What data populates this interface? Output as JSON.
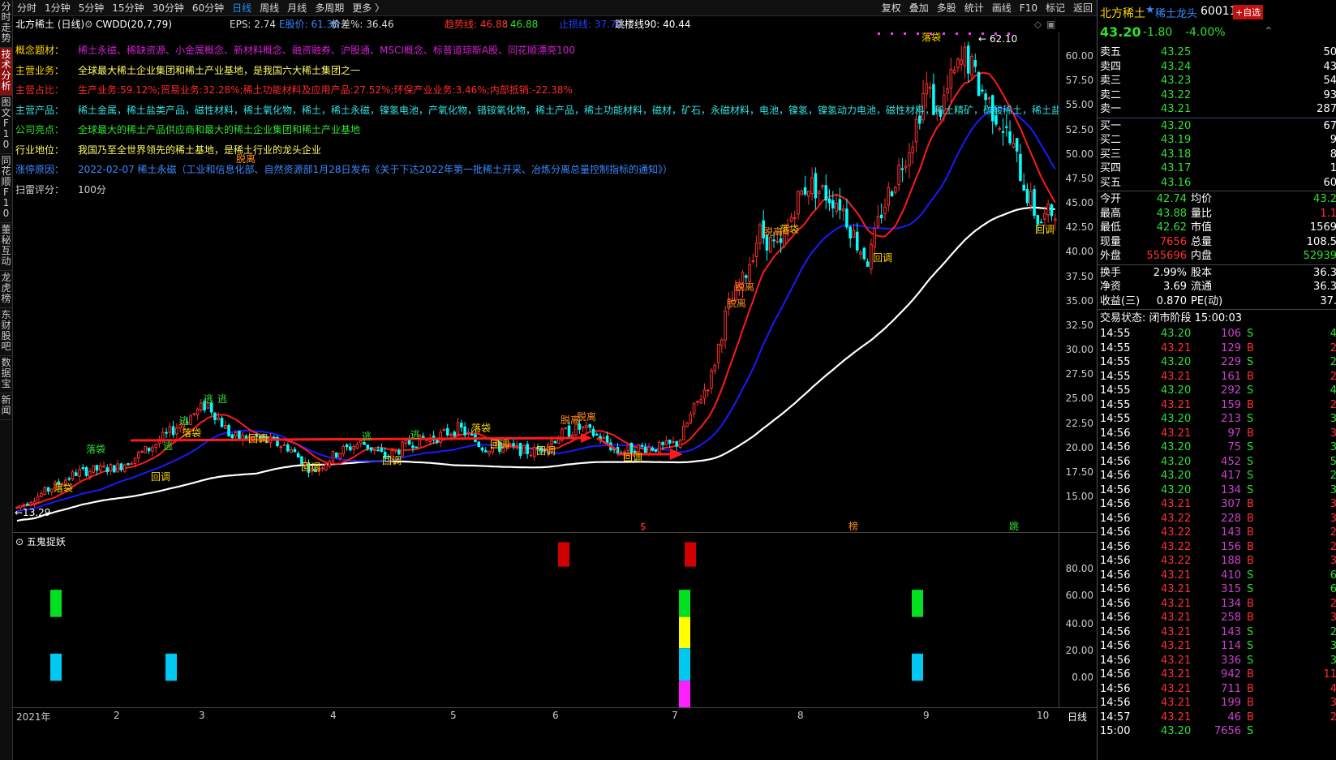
{
  "left_tabs": [
    "分时走势",
    "技术分析",
    "图文F10",
    "同花顺F10",
    "董秘互动",
    "龙虎榜",
    "东财股吧",
    "数据宝",
    "新闻"
  ],
  "left_tab_active": 1,
  "top_menu": [
    "分时",
    "1分钟",
    "5分钟",
    "15分钟",
    "30分钟",
    "60分钟",
    "日线",
    "周线",
    "月线",
    "多周期",
    "更多 〉"
  ],
  "top_menu_active": "日线",
  "top_right": [
    "复权",
    "叠加",
    "多股",
    "统计",
    "画线",
    "F10",
    "标记",
    "返回"
  ],
  "info": {
    "name": "北方稀土 (日线)",
    "indicator": "CWDD(20,7,79)",
    "eps": "EPS: 2.74",
    "e_price": "E股价: 61.38",
    "price_diff": "价差%: 36.46",
    "trend": "趋势线: 46.88",
    "trend2": ": 46.88",
    "stop": "止损线: 37.72",
    "jump": "跳楼线90: 40.44"
  },
  "fundamentals": [
    {
      "label": "概念题材：",
      "value": "稀土永磁、稀缺资源、小金属概念、新材料概念、融资融券、沪股通、MSCI概念、标普道琼斯A股、同花顺漂亮100",
      "color": "#d020d0",
      "lcolor": "#ffd700"
    },
    {
      "label": "主营业务：",
      "value": "全球最大稀土企业集团和稀土产业基地，是我国六大稀土集团之一",
      "color": "#fffa60",
      "lcolor": "#ffd700"
    },
    {
      "label": "主营占比：",
      "value": "生产业务:59.12%;贸易业务:32.28%;稀土功能材料及应用产品:27.52%;环保产业业务:3.46%;内部抵销:-22.38%",
      "color": "#ff2a2a",
      "lcolor": "#ff2a2a"
    },
    {
      "label": "主营产品：",
      "value": "稀土金属，稀土盐类产品，磁性材料，稀土氧化物，稀土，稀土永磁，镍氢电池，产氧化物，错铵氧化物，稀土产品，稀土功能材料，磁材，矿石，永磁材料，电池，镍氢，镍氢动力电池，磁性材料，稀土精矿，碳酸稀土，稀土盐类，稀土硅",
      "color": "#33e0e0",
      "lcolor": "#33e0e0"
    },
    {
      "label": "公司亮点：",
      "value": "全球最大的稀土产品供应商和最大的稀土企业集团和稀土产业基地",
      "color": "#30e030",
      "lcolor": "#30e030"
    },
    {
      "label": "行业地位：",
      "value": "我国乃至全世界领先的稀土基地，是稀土行业的龙头企业",
      "color": "#fffa60",
      "lcolor": "#fffa60"
    },
    {
      "label": "涨停原因：",
      "value": "2022-02-07 稀土永磁（工业和信息化部、自然资源部1月28日发布《关于下达2022年第一批稀土开采、冶炼分离总量控制指标的通知》）",
      "color": "#3a8aff",
      "lcolor": "#3a8aff"
    },
    {
      "label": "扫雷评分：",
      "value": "100分",
      "color": "#d0d0d0",
      "lcolor": "#d0d0d0"
    }
  ],
  "y_labels": [
    "60.00",
    "57.50",
    "55.00",
    "52.50",
    "50.00",
    "47.50",
    "45.00",
    "42.50",
    "40.00",
    "37.50",
    "35.00",
    "32.50",
    "30.00",
    "27.50",
    "25.00",
    "22.50",
    "20.00",
    "17.50",
    "15.00"
  ],
  "sub_y_labels": [
    "80.00",
    "60.00",
    "40.00",
    "20.00",
    "0.00"
  ],
  "x_labels": [
    "2021年",
    "2",
    "3",
    "4",
    "5",
    "6",
    "7",
    "8",
    "9",
    "10"
  ],
  "x_right": "日线",
  "sub_title": "五鬼捉妖",
  "high_label": "62.10",
  "low_label": "13.29",
  "marker_labels": {
    "s": "$",
    "bang": "榜",
    "jump": "跳"
  },
  "signal_text": {
    "huitiao": "回调",
    "tuoli": "脱离",
    "luodai": "落袋",
    "tao": "逃",
    "tuolihi": "落袋"
  },
  "chart_data": {
    "type": "candlestick",
    "ylim": [
      12.5,
      62.5
    ],
    "annotated_high": 62.1,
    "annotated_low": 13.29,
    "last_close": 43.2,
    "indicator_values": {
      "trend": 46.88,
      "stop": 37.72,
      "jump90": 40.44
    },
    "sub_indicator": "五鬼捉妖",
    "sub_ylim": [
      -20,
      100
    ]
  },
  "quote": {
    "name": "北方稀土",
    "star": "★",
    "tag": "稀土龙头",
    "code": "600111",
    "add_btn": "+自选",
    "price": "43.20",
    "change": "-1.80",
    "pct": "-4.00%",
    "asks": [
      [
        "卖五",
        "43.25",
        "50"
      ],
      [
        "卖四",
        "43.24",
        "43"
      ],
      [
        "卖三",
        "43.23",
        "54"
      ],
      [
        "卖二",
        "43.22",
        "93"
      ],
      [
        "卖一",
        "43.21",
        "287"
      ]
    ],
    "bids": [
      [
        "买一",
        "43.20",
        "67"
      ],
      [
        "买二",
        "43.19",
        "9"
      ],
      [
        "买三",
        "43.18",
        "8"
      ],
      [
        "买四",
        "43.17",
        "1"
      ],
      [
        "买五",
        "43.16",
        "60"
      ]
    ],
    "stats": [
      [
        "今开",
        "42.74",
        "均价",
        "43.2"
      ],
      [
        "最高",
        "43.88",
        "量比",
        "1.1"
      ],
      [
        "最低",
        "42.62",
        "市值",
        "1569"
      ],
      [
        "现量",
        "7656",
        "总量",
        "108.5"
      ],
      [
        "外盘",
        "555696",
        "内盘",
        "52939"
      ]
    ],
    "stats2": [
      [
        "换手",
        "2.99%",
        "股本",
        "36.3"
      ],
      [
        "净资",
        "3.69",
        "流通",
        "36.3"
      ],
      [
        "收益(三)",
        "0.870",
        "PE(动)",
        "37."
      ]
    ],
    "status": "交易状态: 闭市阶段 15:00:03",
    "ticks": [
      [
        "14:55",
        "43.20",
        "106",
        "S",
        "4"
      ],
      [
        "14:55",
        "43.21",
        "129",
        "B",
        "2"
      ],
      [
        "14:55",
        "43.20",
        "229",
        "S",
        "2"
      ],
      [
        "14:55",
        "43.21",
        "161",
        "B",
        "2"
      ],
      [
        "14:55",
        "43.20",
        "292",
        "S",
        "4"
      ],
      [
        "14:55",
        "43.21",
        "159",
        "B",
        "2"
      ],
      [
        "14:55",
        "43.20",
        "213",
        "S",
        "3"
      ],
      [
        "14:56",
        "43.21",
        "97",
        "B",
        "3"
      ],
      [
        "14:56",
        "43.20",
        "75",
        "S",
        "3"
      ],
      [
        "14:56",
        "43.20",
        "452",
        "S",
        "5"
      ],
      [
        "14:56",
        "43.20",
        "417",
        "S",
        "2"
      ],
      [
        "14:56",
        "43.20",
        "134",
        "S",
        "3"
      ],
      [
        "14:56",
        "43.21",
        "307",
        "B",
        "3"
      ],
      [
        "14:56",
        "43.22",
        "228",
        "B",
        "3"
      ],
      [
        "14:56",
        "43.22",
        "143",
        "B",
        "2"
      ],
      [
        "14:56",
        "43.22",
        "156",
        "B",
        "2"
      ],
      [
        "14:56",
        "43.22",
        "188",
        "B",
        "3"
      ],
      [
        "14:56",
        "43.21",
        "410",
        "S",
        "6"
      ],
      [
        "14:56",
        "43.21",
        "315",
        "S",
        "6"
      ],
      [
        "14:56",
        "43.21",
        "134",
        "B",
        "2"
      ],
      [
        "14:56",
        "43.21",
        "258",
        "B",
        "3"
      ],
      [
        "14:56",
        "43.21",
        "143",
        "S",
        "2"
      ],
      [
        "14:56",
        "43.21",
        "114",
        "S",
        "3"
      ],
      [
        "14:56",
        "43.21",
        "336",
        "S",
        "3"
      ],
      [
        "14:56",
        "43.21",
        "942",
        "B",
        "11"
      ],
      [
        "14:56",
        "43.21",
        "711",
        "B",
        "4"
      ],
      [
        "14:56",
        "43.21",
        "199",
        "B",
        "3"
      ],
      [
        "14:57",
        "43.21",
        "46",
        "B",
        "2"
      ],
      [
        "15:00",
        "43.20",
        "7656",
        "S",
        ""
      ]
    ]
  },
  "colors": {
    "up": "#ff3030",
    "down": "#00ffff",
    "green": "#30e030",
    "ma_red": "#ff1a1a",
    "ma_blue": "#1a1aff",
    "ma_white": "#ffffff",
    "purple": "#d040d0"
  }
}
